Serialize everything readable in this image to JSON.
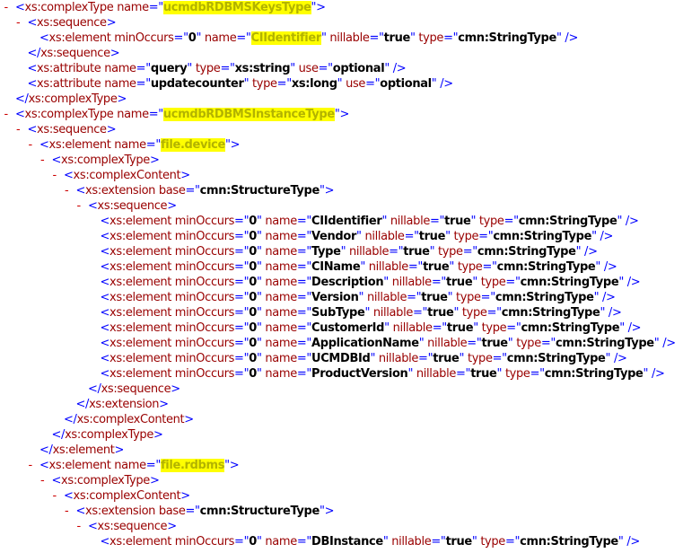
{
  "toggle_symbol": "-",
  "lines": [
    {
      "indent": 1,
      "toggle": true,
      "kind": "open",
      "tag": "xs:complexType",
      "attrs": [
        {
          "n": "name",
          "v": "ucmdbRDBMSKeysType",
          "hl": true
        }
      ]
    },
    {
      "indent": 2,
      "toggle": true,
      "kind": "open",
      "tag": "xs:sequence",
      "attrs": []
    },
    {
      "indent": 3,
      "toggle": false,
      "kind": "empty",
      "tag": "xs:element",
      "attrs": [
        {
          "n": "minOccurs",
          "v": "0"
        },
        {
          "n": "name",
          "v": "CIIdentifier",
          "hl": true
        },
        {
          "n": "nillable",
          "v": "true"
        },
        {
          "n": "type",
          "v": "cmn:StringType"
        }
      ]
    },
    {
      "indent": 2,
      "toggle": false,
      "kind": "close",
      "tag": "xs:sequence"
    },
    {
      "indent": 2,
      "toggle": false,
      "kind": "empty",
      "tag": "xs:attribute",
      "attrs": [
        {
          "n": "name",
          "v": "query"
        },
        {
          "n": "type",
          "v": "xs:string"
        },
        {
          "n": "use",
          "v": "optional"
        }
      ]
    },
    {
      "indent": 2,
      "toggle": false,
      "kind": "empty",
      "tag": "xs:attribute",
      "attrs": [
        {
          "n": "name",
          "v": "updatecounter"
        },
        {
          "n": "type",
          "v": "xs:long"
        },
        {
          "n": "use",
          "v": "optional"
        }
      ]
    },
    {
      "indent": 1,
      "toggle": false,
      "kind": "close",
      "tag": "xs:complexType"
    },
    {
      "indent": 1,
      "toggle": true,
      "kind": "open",
      "tag": "xs:complexType",
      "attrs": [
        {
          "n": "name",
          "v": "ucmdbRDBMSInstanceType",
          "hl": true
        }
      ]
    },
    {
      "indent": 2,
      "toggle": true,
      "kind": "open",
      "tag": "xs:sequence",
      "attrs": []
    },
    {
      "indent": 3,
      "toggle": true,
      "kind": "open",
      "tag": "xs:element",
      "attrs": [
        {
          "n": "name",
          "v": "file.device",
          "hl": true
        }
      ]
    },
    {
      "indent": 4,
      "toggle": true,
      "kind": "open",
      "tag": "xs:complexType",
      "attrs": []
    },
    {
      "indent": 5,
      "toggle": true,
      "kind": "open",
      "tag": "xs:complexContent",
      "attrs": []
    },
    {
      "indent": 6,
      "toggle": true,
      "kind": "open",
      "tag": "xs:extension",
      "attrs": [
        {
          "n": "base",
          "v": "cmn:StructureType"
        }
      ]
    },
    {
      "indent": 7,
      "toggle": true,
      "kind": "open",
      "tag": "xs:sequence",
      "attrs": []
    },
    {
      "indent": 8,
      "toggle": false,
      "kind": "empty",
      "tag": "xs:element",
      "attrs": [
        {
          "n": "minOccurs",
          "v": "0"
        },
        {
          "n": "name",
          "v": "CIIdentifier"
        },
        {
          "n": "nillable",
          "v": "true"
        },
        {
          "n": "type",
          "v": "cmn:StringType"
        }
      ]
    },
    {
      "indent": 8,
      "toggle": false,
      "kind": "empty",
      "tag": "xs:element",
      "attrs": [
        {
          "n": "minOccurs",
          "v": "0"
        },
        {
          "n": "name",
          "v": "Vendor"
        },
        {
          "n": "nillable",
          "v": "true"
        },
        {
          "n": "type",
          "v": "cmn:StringType"
        }
      ]
    },
    {
      "indent": 8,
      "toggle": false,
      "kind": "empty",
      "tag": "xs:element",
      "attrs": [
        {
          "n": "minOccurs",
          "v": "0"
        },
        {
          "n": "name",
          "v": "Type"
        },
        {
          "n": "nillable",
          "v": "true"
        },
        {
          "n": "type",
          "v": "cmn:StringType"
        }
      ]
    },
    {
      "indent": 8,
      "toggle": false,
      "kind": "empty",
      "tag": "xs:element",
      "attrs": [
        {
          "n": "minOccurs",
          "v": "0"
        },
        {
          "n": "name",
          "v": "CIName"
        },
        {
          "n": "nillable",
          "v": "true"
        },
        {
          "n": "type",
          "v": "cmn:StringType"
        }
      ]
    },
    {
      "indent": 8,
      "toggle": false,
      "kind": "empty",
      "tag": "xs:element",
      "attrs": [
        {
          "n": "minOccurs",
          "v": "0"
        },
        {
          "n": "name",
          "v": "Description"
        },
        {
          "n": "nillable",
          "v": "true"
        },
        {
          "n": "type",
          "v": "cmn:StringType"
        }
      ]
    },
    {
      "indent": 8,
      "toggle": false,
      "kind": "empty",
      "tag": "xs:element",
      "attrs": [
        {
          "n": "minOccurs",
          "v": "0"
        },
        {
          "n": "name",
          "v": "Version"
        },
        {
          "n": "nillable",
          "v": "true"
        },
        {
          "n": "type",
          "v": "cmn:StringType"
        }
      ]
    },
    {
      "indent": 8,
      "toggle": false,
      "kind": "empty",
      "tag": "xs:element",
      "attrs": [
        {
          "n": "minOccurs",
          "v": "0"
        },
        {
          "n": "name",
          "v": "SubType"
        },
        {
          "n": "nillable",
          "v": "true"
        },
        {
          "n": "type",
          "v": "cmn:StringType"
        }
      ]
    },
    {
      "indent": 8,
      "toggle": false,
      "kind": "empty",
      "tag": "xs:element",
      "attrs": [
        {
          "n": "minOccurs",
          "v": "0"
        },
        {
          "n": "name",
          "v": "CustomerId"
        },
        {
          "n": "nillable",
          "v": "true"
        },
        {
          "n": "type",
          "v": "cmn:StringType"
        }
      ]
    },
    {
      "indent": 8,
      "toggle": false,
      "kind": "empty",
      "tag": "xs:element",
      "attrs": [
        {
          "n": "minOccurs",
          "v": "0"
        },
        {
          "n": "name",
          "v": "ApplicationName"
        },
        {
          "n": "nillable",
          "v": "true"
        },
        {
          "n": "type",
          "v": "cmn:StringType"
        }
      ]
    },
    {
      "indent": 8,
      "toggle": false,
      "kind": "empty",
      "tag": "xs:element",
      "attrs": [
        {
          "n": "minOccurs",
          "v": "0"
        },
        {
          "n": "name",
          "v": "UCMDBId"
        },
        {
          "n": "nillable",
          "v": "true"
        },
        {
          "n": "type",
          "v": "cmn:StringType"
        }
      ]
    },
    {
      "indent": 8,
      "toggle": false,
      "kind": "empty",
      "tag": "xs:element",
      "attrs": [
        {
          "n": "minOccurs",
          "v": "0"
        },
        {
          "n": "name",
          "v": "ProductVersion"
        },
        {
          "n": "nillable",
          "v": "true"
        },
        {
          "n": "type",
          "v": "cmn:StringType"
        }
      ]
    },
    {
      "indent": 7,
      "toggle": false,
      "kind": "close",
      "tag": "xs:sequence"
    },
    {
      "indent": 6,
      "toggle": false,
      "kind": "close",
      "tag": "xs:extension"
    },
    {
      "indent": 5,
      "toggle": false,
      "kind": "close",
      "tag": "xs:complexContent"
    },
    {
      "indent": 4,
      "toggle": false,
      "kind": "close",
      "tag": "xs:complexType"
    },
    {
      "indent": 3,
      "toggle": false,
      "kind": "close",
      "tag": "xs:element"
    },
    {
      "indent": 3,
      "toggle": true,
      "kind": "open",
      "tag": "xs:element",
      "attrs": [
        {
          "n": "name",
          "v": "file.rdbms",
          "hl": true
        }
      ]
    },
    {
      "indent": 4,
      "toggle": true,
      "kind": "open",
      "tag": "xs:complexType",
      "attrs": []
    },
    {
      "indent": 5,
      "toggle": true,
      "kind": "open",
      "tag": "xs:complexContent",
      "attrs": []
    },
    {
      "indent": 6,
      "toggle": true,
      "kind": "open",
      "tag": "xs:extension",
      "attrs": [
        {
          "n": "base",
          "v": "cmn:StructureType"
        }
      ]
    },
    {
      "indent": 7,
      "toggle": true,
      "kind": "open",
      "tag": "xs:sequence",
      "attrs": []
    },
    {
      "indent": 8,
      "toggle": false,
      "kind": "empty",
      "tag": "xs:element",
      "attrs": [
        {
          "n": "minOccurs",
          "v": "0"
        },
        {
          "n": "name",
          "v": "DBInstance"
        },
        {
          "n": "nillable",
          "v": "true"
        },
        {
          "n": "type",
          "v": "cmn:StringType"
        }
      ]
    }
  ]
}
